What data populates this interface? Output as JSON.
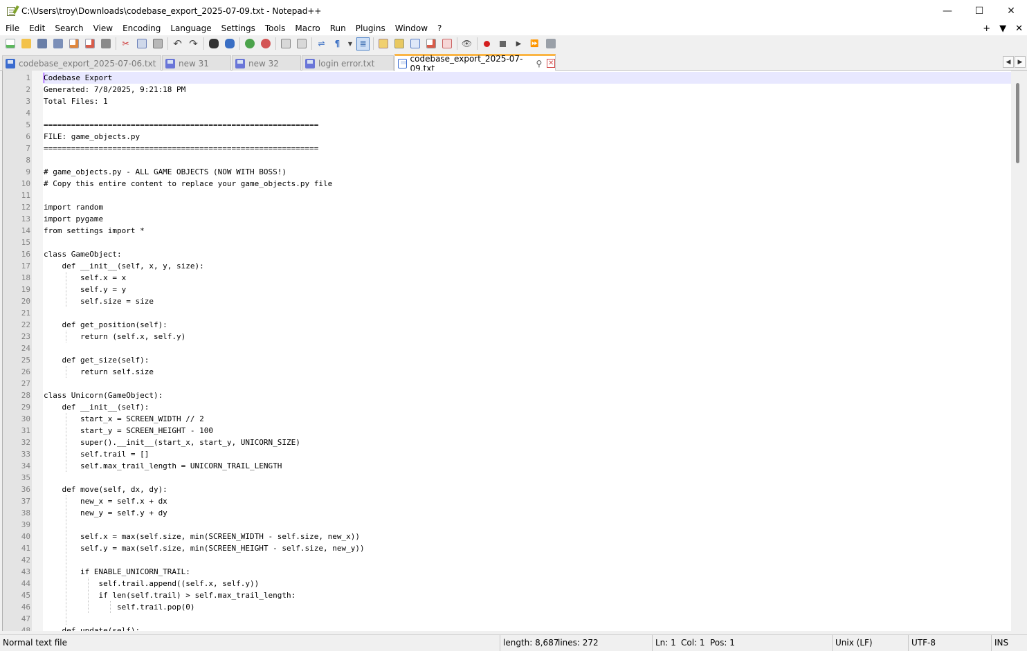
{
  "window": {
    "title": "C:\\Users\\troy\\Downloads\\codebase_export_2025-07-09.txt - Notepad++",
    "minimize": "—",
    "maximize": "☐",
    "close": "✕"
  },
  "menu": {
    "items": [
      "File",
      "Edit",
      "Search",
      "View",
      "Encoding",
      "Language",
      "Settings",
      "Tools",
      "Macro",
      "Run",
      "Plugins",
      "Window",
      "?"
    ],
    "right": {
      "plus": "+",
      "down": "▼",
      "close": "✕"
    }
  },
  "toolbar": {
    "icons": [
      "new-file-icon",
      "open-file-icon",
      "save-icon",
      "save-all-icon",
      "close-icon",
      "close-all-icon",
      "print-icon",
      "cut-icon",
      "copy-icon",
      "paste-icon",
      "undo-icon",
      "redo-icon",
      "find-icon",
      "replace-icon",
      "zoom-in-icon",
      "zoom-out-icon",
      "sync-vertical-icon",
      "sync-horizontal-icon",
      "word-wrap-icon",
      "show-all-chars-icon",
      "indent-guide-icon",
      "doc-map-icon",
      "folder-workspace-icon",
      "function-list-icon",
      "doc-list-icon",
      "monitor-icon",
      "record-macro-icon",
      "stop-record-icon",
      "play-macro-icon",
      "run-multiple-icon",
      "save-macro-icon"
    ]
  },
  "tabs": [
    {
      "label": "codebase_export_2025-07-06.txt",
      "active": false
    },
    {
      "label": "new 31",
      "active": false
    },
    {
      "label": "new 32",
      "active": false
    },
    {
      "label": "login error.txt",
      "active": false
    },
    {
      "label": "codebase_export_2025-07-09.txt",
      "active": true
    }
  ],
  "tab_controls": {
    "prev": "◀",
    "next": "▶",
    "pin": "📌",
    "close": "✕"
  },
  "editor": {
    "lines": [
      "Codebase Export",
      "Generated: 7/8/2025, 9:21:18 PM",
      "Total Files: 1",
      "",
      "============================================================",
      "FILE: game_objects.py",
      "============================================================",
      "",
      "# game_objects.py - ALL GAME OBJECTS (NOW WITH BOSS!)",
      "# Copy this entire content to replace your game_objects.py file",
      "",
      "import random",
      "import pygame",
      "from settings import *",
      "",
      "class GameObject:",
      "    def __init__(self, x, y, size):",
      "        self.x = x",
      "        self.y = y",
      "        self.size = size",
      "",
      "    def get_position(self):",
      "        return (self.x, self.y)",
      "",
      "    def get_size(self):",
      "        return self.size",
      "",
      "class Unicorn(GameObject):",
      "    def __init__(self):",
      "        start_x = SCREEN_WIDTH // 2",
      "        start_y = SCREEN_HEIGHT - 100",
      "        super().__init__(start_x, start_y, UNICORN_SIZE)",
      "        self.trail = []",
      "        self.max_trail_length = UNICORN_TRAIL_LENGTH",
      "",
      "    def move(self, dx, dy):",
      "        new_x = self.x + dx",
      "        new_y = self.y + dy",
      "",
      "        self.x = max(self.size, min(SCREEN_WIDTH - self.size, new_x))",
      "        self.y = max(self.size, min(SCREEN_HEIGHT - self.size, new_y))",
      "",
      "        if ENABLE_UNICORN_TRAIL:",
      "            self.trail.append((self.x, self.y))",
      "            if len(self.trail) > self.max_trail_length:",
      "                self.trail.pop(0)",
      "",
      "    def update(self):"
    ]
  },
  "status": {
    "file_type": "Normal text file",
    "length": "length: 8,687",
    "lines": "lines: 272",
    "ln": "Ln: 1",
    "col": "Col: 1",
    "pos": "Pos: 1",
    "eol": "Unix (LF)",
    "encoding": "UTF-8",
    "mode": "INS"
  }
}
